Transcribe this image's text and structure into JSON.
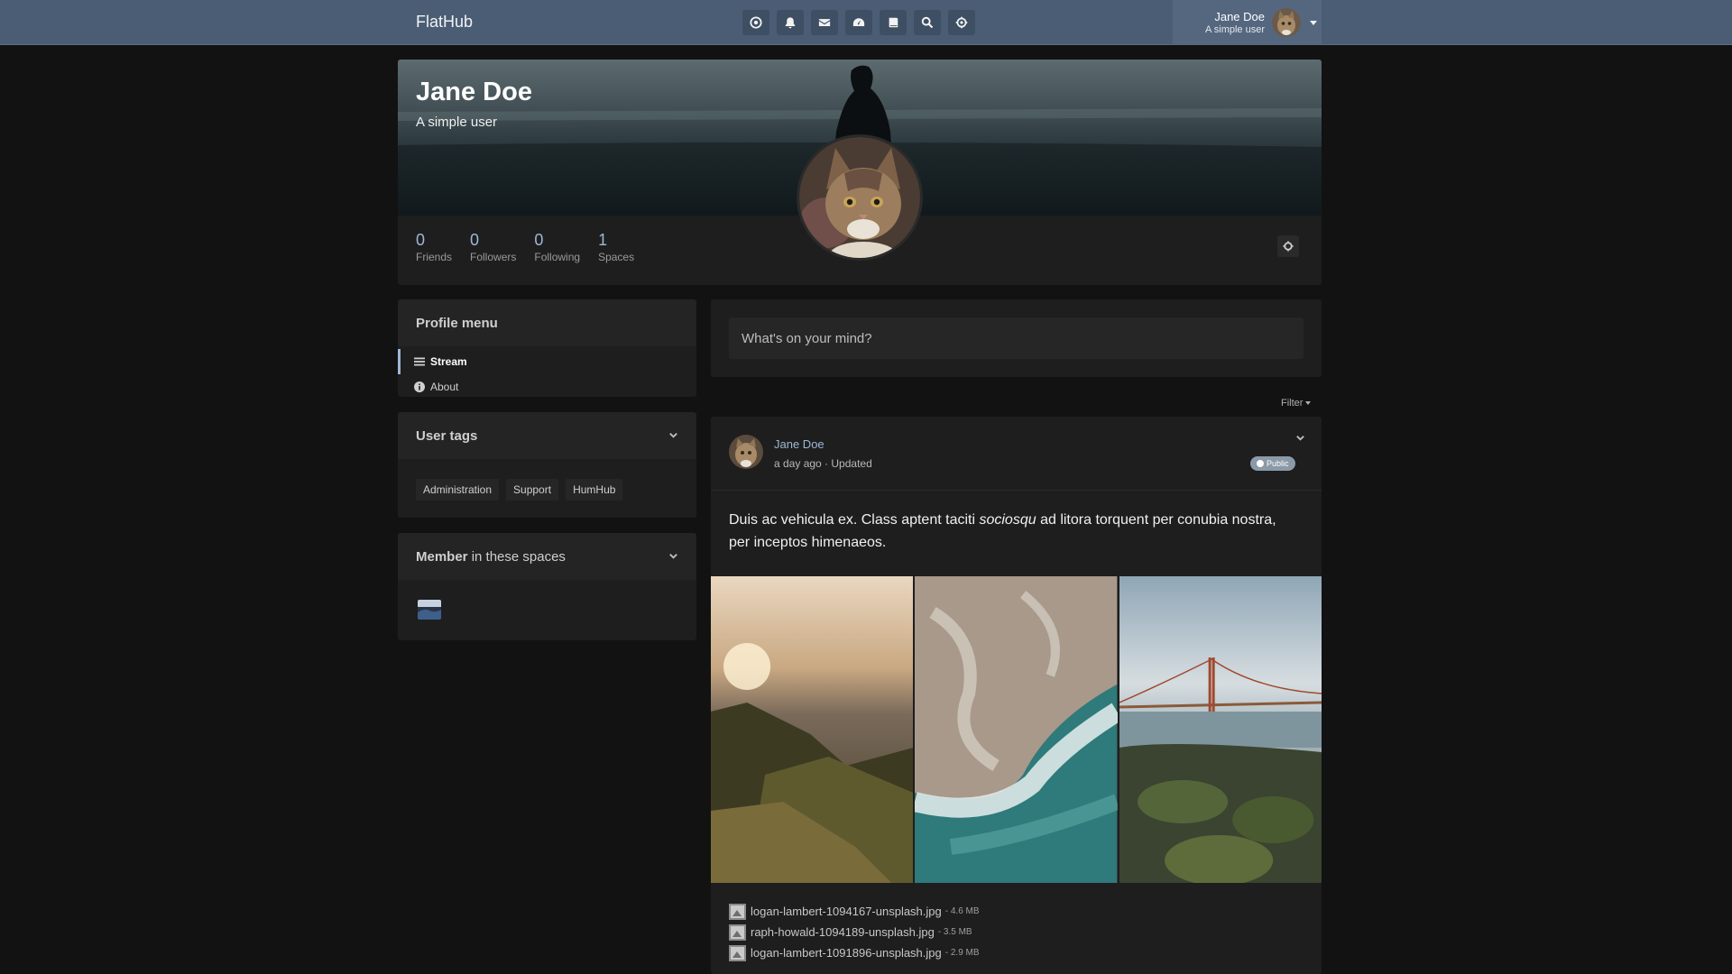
{
  "topbar": {
    "brand": "FlatHub",
    "icons": [
      "dashboard-icon",
      "bell-icon",
      "envelope-icon",
      "tachometer-icon",
      "book-icon",
      "search-icon",
      "gear-icon"
    ],
    "user": {
      "name": "Jane Doe",
      "subtitle": "A simple user"
    }
  },
  "profile": {
    "name": "Jane Doe",
    "subtitle": "A simple user",
    "stats": [
      {
        "value": "0",
        "label": "Friends"
      },
      {
        "value": "0",
        "label": "Followers"
      },
      {
        "value": "0",
        "label": "Following"
      },
      {
        "value": "1",
        "label": "Spaces"
      }
    ]
  },
  "sidebar": {
    "profile_menu": {
      "title": "Profile menu",
      "items": [
        {
          "label": "Stream",
          "icon": "bars-icon",
          "active": true
        },
        {
          "label": "About",
          "icon": "info-icon",
          "active": false
        }
      ]
    },
    "user_tags": {
      "title": "User tags",
      "tags": [
        "Administration",
        "Support",
        "HumHub"
      ]
    },
    "spaces": {
      "title_bold": "Member",
      "title_rest": " in these spaces"
    }
  },
  "composer": {
    "placeholder": "What's on your mind?"
  },
  "filter": {
    "label": "Filter"
  },
  "post": {
    "author": "Jane Doe",
    "meta": "a day ago · Updated",
    "badge": "Public",
    "text_before": "Duis ac vehicula ex. Class aptent taciti ",
    "text_em": "sociosqu",
    "text_after": " ad litora torquent per conubia nostra, per inceptos himenaeos.",
    "files": [
      {
        "name": "logan-lambert-1094167-unsplash.jpg",
        "size": "- 4.6 MB"
      },
      {
        "name": "raph-howald-1094189-unsplash.jpg",
        "size": "- 3.5 MB"
      },
      {
        "name": "logan-lambert-1091896-unsplash.jpg",
        "size": "- 2.9 MB"
      }
    ]
  },
  "colors": {
    "topbar": "#4a5d75",
    "accent": "#9eb8d4",
    "background": "#121212",
    "panel": "#1e1e1e"
  }
}
